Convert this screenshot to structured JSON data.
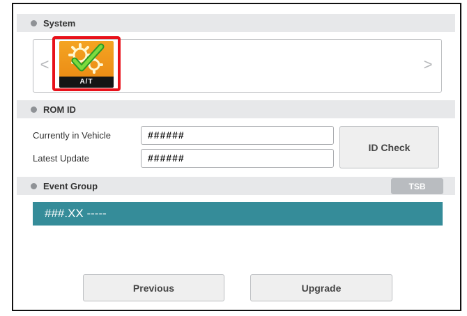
{
  "system": {
    "header": "System",
    "prev_arrow": "<",
    "next_arrow": ">",
    "selected_item": {
      "label": "A/T",
      "icon": "gears-check-icon"
    }
  },
  "rom_id": {
    "header": "ROM ID",
    "currently_label": "Currently in Vehicle",
    "currently_value": "######",
    "latest_label": "Latest Update",
    "latest_value": "######",
    "id_check_label": "ID Check"
  },
  "event_group": {
    "header": "Event Group",
    "tsb_label": "TSB",
    "items": [
      "###.XX -----"
    ]
  },
  "footer": {
    "previous_label": "Previous",
    "upgrade_label": "Upgrade"
  },
  "colors": {
    "accent": "#358c99",
    "highlight": "#e8111a",
    "icon_bg": "#f4a422"
  }
}
